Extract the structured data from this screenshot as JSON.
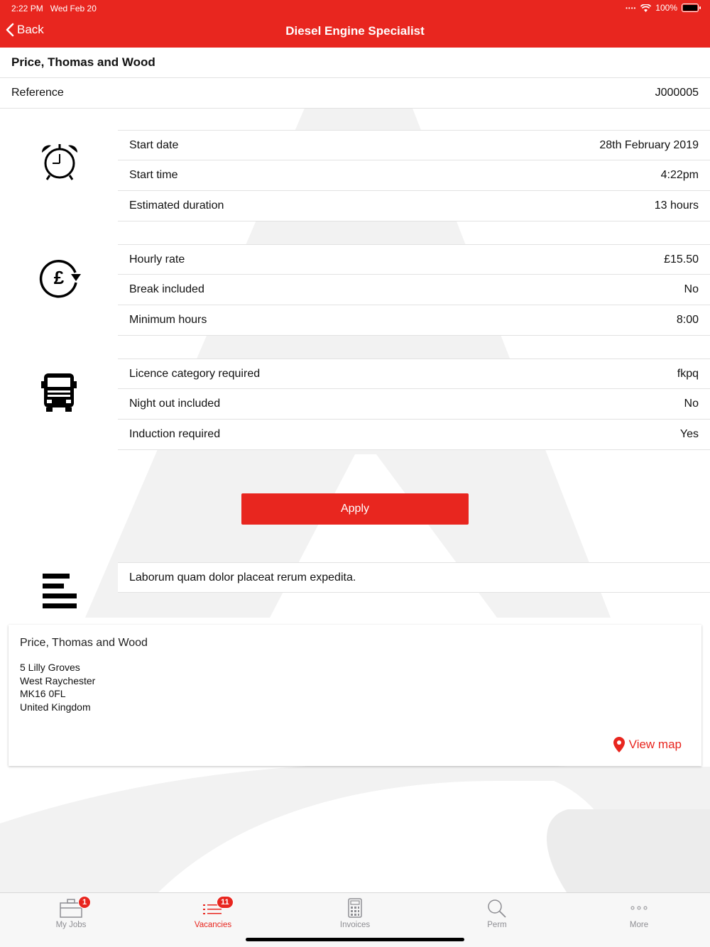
{
  "status_bar": {
    "time": "2:22 PM",
    "date": "Wed Feb 20",
    "battery": "100%"
  },
  "header": {
    "back_label": "Back",
    "title": "Diesel Engine Specialist"
  },
  "company_name": "Price, Thomas and Wood",
  "reference": {
    "label": "Reference",
    "value": "J000005"
  },
  "schedule": {
    "icon": "alarm-clock-icon",
    "rows": [
      {
        "label": "Start date",
        "value": "28th February 2019"
      },
      {
        "label": "Start time",
        "value": "4:22pm"
      },
      {
        "label": "Estimated duration",
        "value": "13 hours"
      }
    ]
  },
  "pay": {
    "icon": "pound-rate-icon",
    "rows": [
      {
        "label": "Hourly rate",
        "value": "£15.50"
      },
      {
        "label": "Break included",
        "value": "No"
      },
      {
        "label": "Minimum hours",
        "value": "8:00"
      }
    ]
  },
  "requirements": {
    "icon": "truck-icon",
    "rows": [
      {
        "label": "Licence category required",
        "value": "fkpq"
      },
      {
        "label": "Night out included",
        "value": "No"
      },
      {
        "label": "Induction required",
        "value": "Yes"
      }
    ]
  },
  "apply_label": "Apply",
  "description": {
    "icon": "text-align-icon",
    "text": "Laborum quam dolor placeat rerum expedita."
  },
  "address": {
    "company": "Price, Thomas and Wood",
    "line1": "5 Lilly Groves",
    "line2": "West Raychester",
    "line3": "MK16 0FL",
    "line4": "United Kingdom",
    "view_map_label": "View map"
  },
  "tabs": [
    {
      "label": "My Jobs",
      "icon": "briefcase-icon",
      "badge": "1"
    },
    {
      "label": "Vacancies",
      "icon": "list-icon",
      "badge": "11"
    },
    {
      "label": "Invoices",
      "icon": "calculator-icon",
      "badge": ""
    },
    {
      "label": "Perm",
      "icon": "search-icon",
      "badge": ""
    },
    {
      "label": "More",
      "icon": "more-icon",
      "badge": ""
    }
  ],
  "colors": {
    "accent": "#e8261f",
    "tab_inactive": "#8e8e93"
  }
}
